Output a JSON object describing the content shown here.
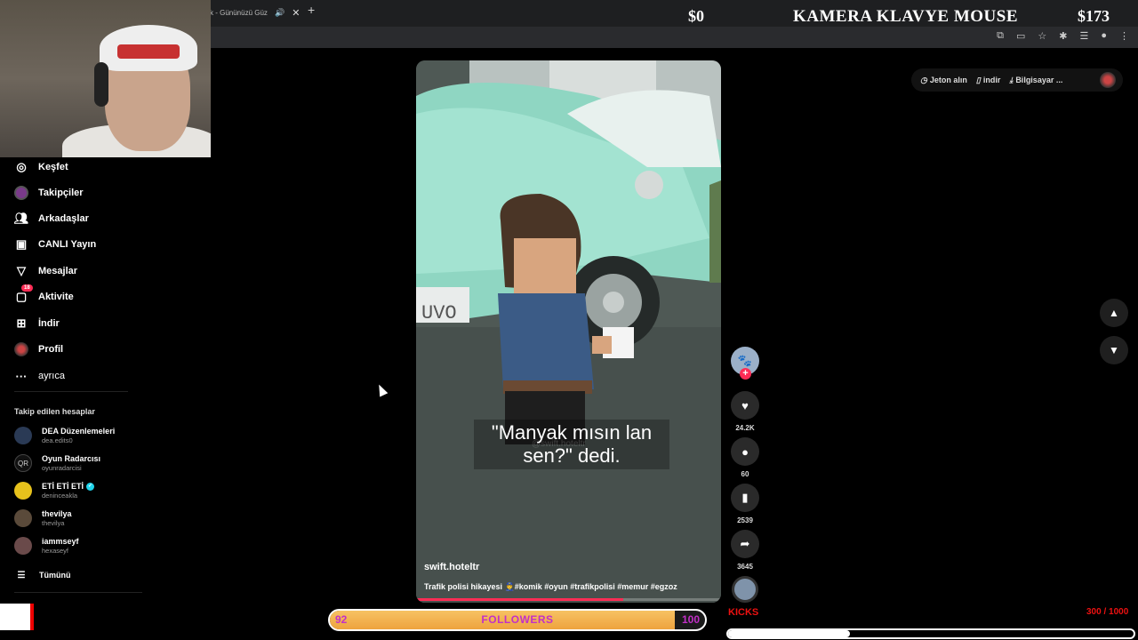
{
  "browser": {
    "tab_title": "k - Gününüzü Güz",
    "tab_sound_icon": "speaker-icon",
    "tab_close": "✕",
    "new_tab": "+"
  },
  "overlay": {
    "money_left": "$0",
    "title": "KAMERA KLAVYE MOUSE",
    "money_right": "$173"
  },
  "sidebar": {
    "items": [
      {
        "label": "Keşfet",
        "icon": "compass-icon"
      },
      {
        "label": "Takipçiler",
        "icon": "followers-avatar-icon"
      },
      {
        "label": "Arkadaşlar",
        "icon": "friends-icon"
      },
      {
        "label": "CANLI Yayın",
        "icon": "live-tv-icon"
      },
      {
        "label": "Mesajlar",
        "icon": "send-icon"
      },
      {
        "label": "Aktivite",
        "icon": "inbox-icon",
        "badge": "18"
      },
      {
        "label": "İndir",
        "icon": "download-box-icon"
      },
      {
        "label": "Profil",
        "icon": "profile-avatar-icon"
      },
      {
        "label": "ayrıca",
        "icon": "more-icon"
      }
    ],
    "followed_title": "Takip edilen hesaplar",
    "accounts": [
      {
        "name": "DEA Düzenlemeleri",
        "handle": "dea.edits0",
        "color": "#2a3a55"
      },
      {
        "name": "Oyun Radarcısı",
        "handle": "oyunradarcisi",
        "color": "#111111"
      },
      {
        "name": "ETİ ETİ ETİ",
        "handle": "deninceakla",
        "color": "#e7c21c",
        "verified": true
      },
      {
        "name": "thevilya",
        "handle": "thevilya",
        "color": "#5a4a3a"
      },
      {
        "name": "iammseyf",
        "handle": "hexaseyf",
        "color": "#6a4a4a"
      }
    ],
    "see_all": "Tümünü"
  },
  "topbar": {
    "coins": "Jeton alın",
    "download": "indir",
    "desktop": "Bilgisayar ..."
  },
  "video": {
    "caption": "\"Manyak mısın lan sen?\" dedi.",
    "watermark": "@swift.hoteltr",
    "username": "swift.hoteltr",
    "description": "Trafik polisi hikayesi 👮‍♂️#komik #oyun #trafikpolisi #memur #egzoz",
    "progress": 0.68
  },
  "actions": {
    "likes": "24.2K",
    "comments": "60",
    "saves": "2539",
    "shares": "3645"
  },
  "followers_goal": {
    "current": "92",
    "label": "FOLLOWERS",
    "max": "100",
    "progress": 0.92
  },
  "kicks": {
    "label": "KICKS",
    "current": "300",
    "max": "1000",
    "display": "300 / 1000",
    "progress": 0.3
  }
}
